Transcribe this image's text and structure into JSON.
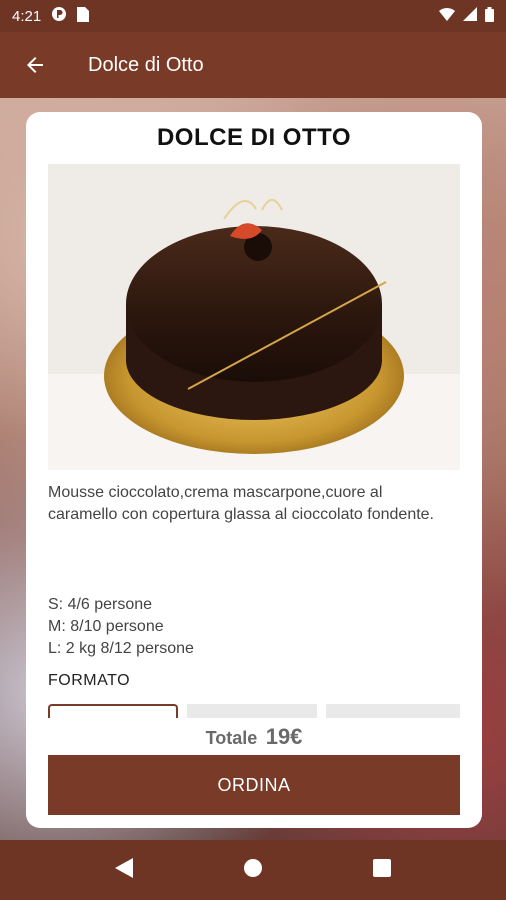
{
  "status_bar": {
    "time": "4:21"
  },
  "app_bar": {
    "title": "Dolce di Otto"
  },
  "product": {
    "name": "DOLCE DI OTTO",
    "description": "Mousse cioccolato,crema mascarpone,cuore al caramello con copertura glassa al cioccolato fondente.",
    "sizes": [
      "S: 4/6 persone",
      "M: 8/10 persone",
      "L: 2 kg 8/12 persone"
    ]
  },
  "formato": {
    "label": "FORMATO"
  },
  "total": {
    "label": "Totale",
    "value": "19€"
  },
  "order_button": {
    "label": "ORDINA"
  },
  "colors": {
    "primary": "#7a3a28",
    "status_bar": "#6e3525",
    "card": "#ffffff"
  },
  "icons": [
    "back-arrow-icon",
    "wifi-icon",
    "signal-icon",
    "battery-icon",
    "nav-back-icon",
    "nav-home-icon",
    "nav-recents-icon"
  ]
}
